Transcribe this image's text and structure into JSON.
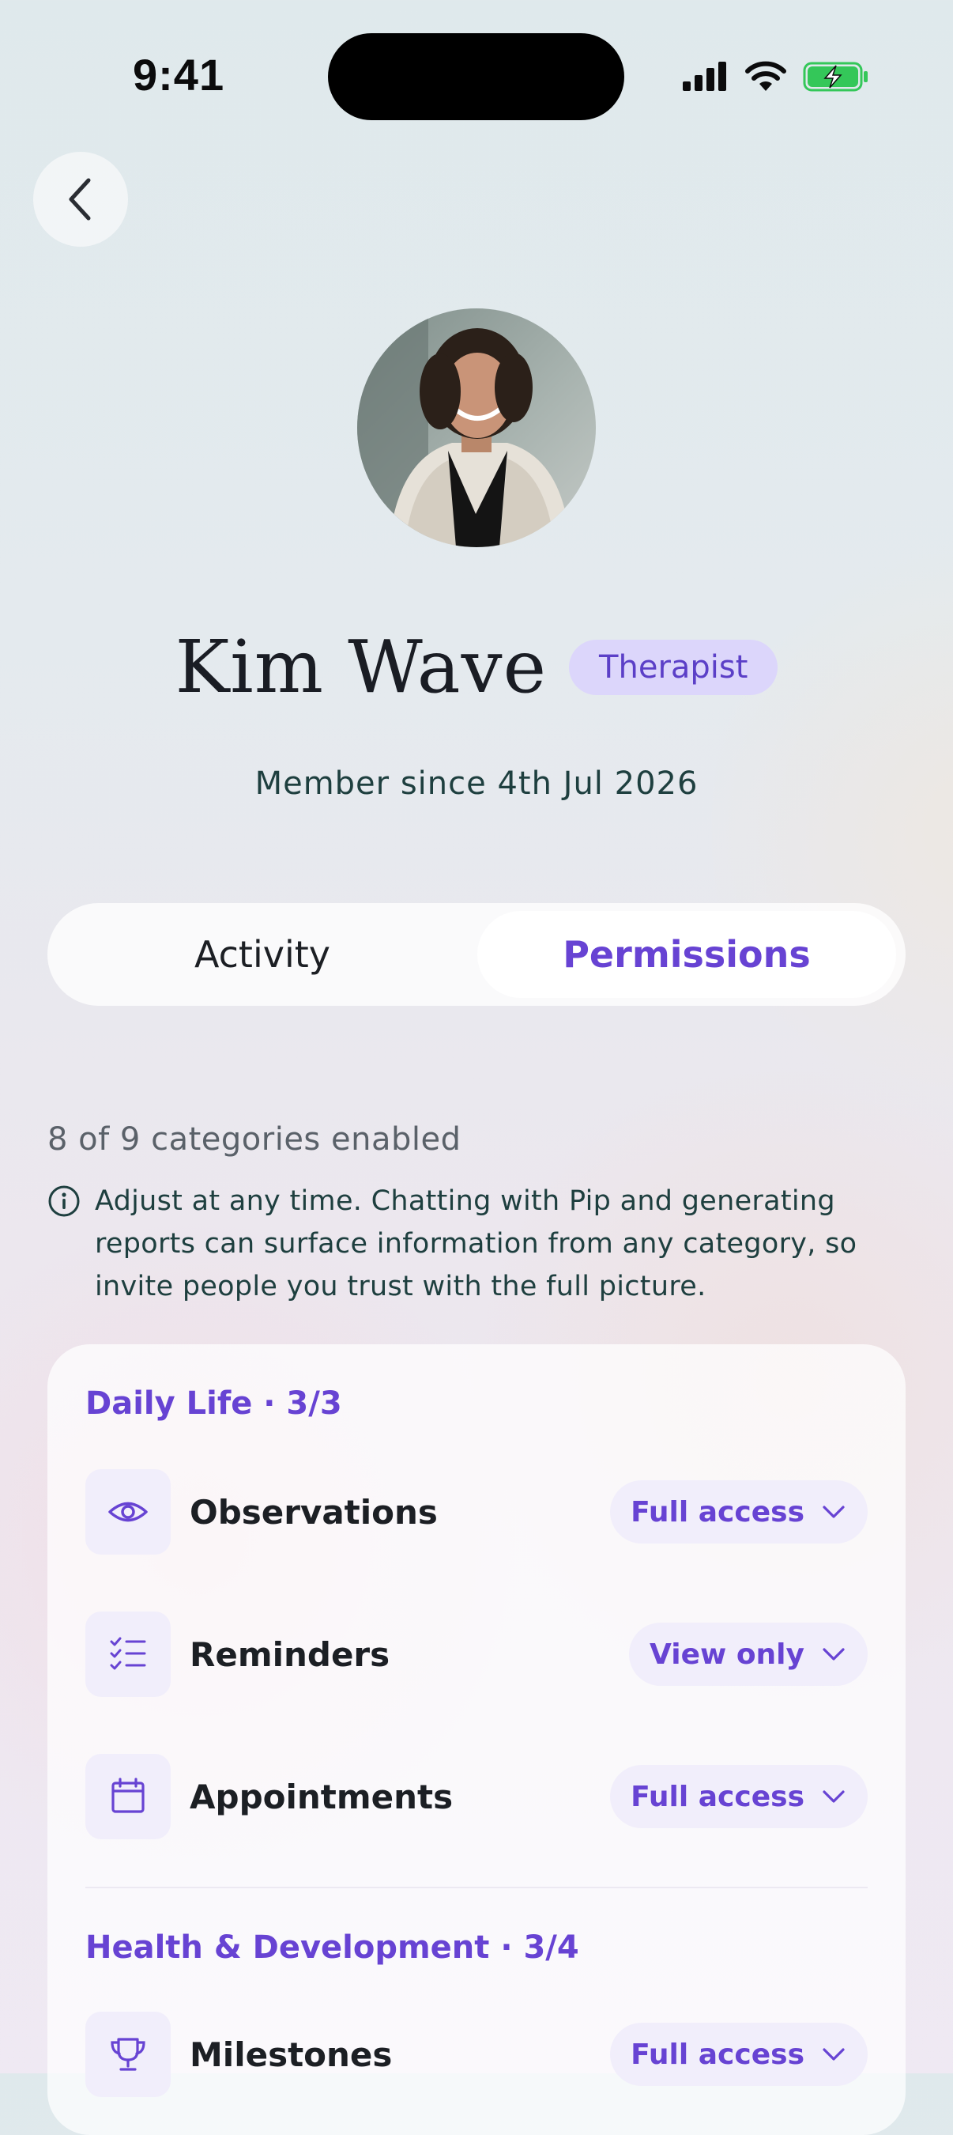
{
  "status_bar": {
    "time": "9:41"
  },
  "profile": {
    "name": "Kim Wave",
    "role": "Therapist",
    "member_since": "Member since 4th Jul 2026"
  },
  "tabs": [
    {
      "label": "Activity",
      "selected": false
    },
    {
      "label": "Permissions",
      "selected": true
    }
  ],
  "permissions": {
    "summary": "8 of 9 categories enabled",
    "info": "Adjust at any time. Chatting with Pip and generating reports can surface information from any category, so invite people you trust with the full picture.",
    "sections": [
      {
        "title": "Daily Life · 3/3",
        "items": [
          {
            "label": "Observations",
            "icon": "eye-icon",
            "access": "Full access"
          },
          {
            "label": "Reminders",
            "icon": "checklist-icon",
            "access": "View only"
          },
          {
            "label": "Appointments",
            "icon": "calendar-icon",
            "access": "Full access"
          }
        ]
      },
      {
        "title": "Health & Development · 3/4",
        "items": [
          {
            "label": "Milestones",
            "icon": "trophy-icon",
            "access": "Full access"
          }
        ]
      }
    ]
  },
  "colors": {
    "accent": "#6743d3",
    "badge_bg": "#dcd6fb",
    "icon_bg": "#f1eefb",
    "battery_green": "#34c759"
  }
}
